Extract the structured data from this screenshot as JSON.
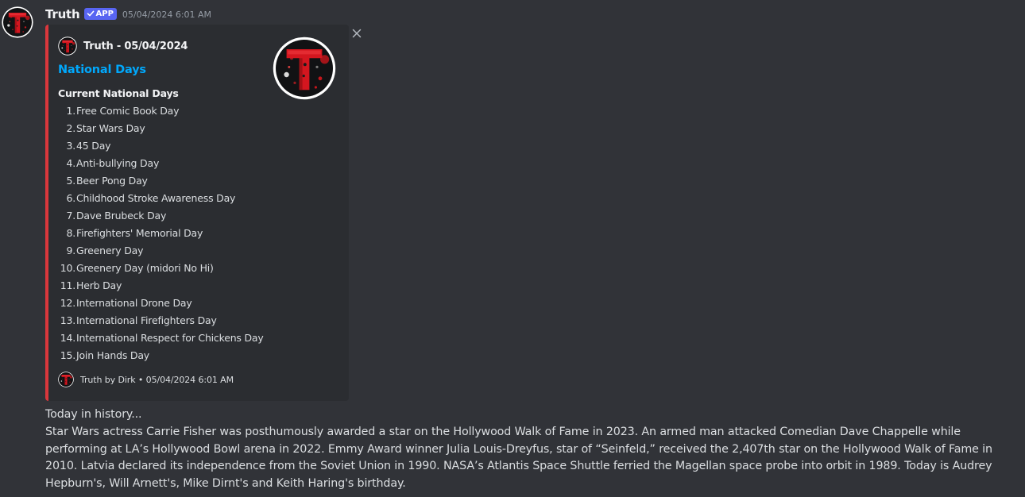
{
  "message": {
    "username": "Truth",
    "badge": "APP",
    "timestamp": "05/04/2024 6:01 AM",
    "avatar_icon": "truth-logo-icon"
  },
  "embed": {
    "accent_color": "#da373c",
    "author": "Truth - 05/04/2024",
    "title": "National Days",
    "field_name": "Current National Days",
    "days": [
      {
        "num": "1.",
        "label": "Free Comic Book Day"
      },
      {
        "num": "2.",
        "label": "Star Wars Day"
      },
      {
        "num": "3.",
        "label": "45 Day"
      },
      {
        "num": "4.",
        "label": "Anti-bullying Day"
      },
      {
        "num": "5.",
        "label": "Beer Pong Day"
      },
      {
        "num": "6.",
        "label": "Childhood Stroke Awareness Day"
      },
      {
        "num": "7.",
        "label": "Dave Brubeck Day"
      },
      {
        "num": "8.",
        "label": "Firefighters' Memorial Day"
      },
      {
        "num": "9.",
        "label": "Greenery Day"
      },
      {
        "num": "10.",
        "label": "Greenery Day (midori No Hi)"
      },
      {
        "num": "11.",
        "label": "Herb Day"
      },
      {
        "num": "12.",
        "label": "International Drone Day"
      },
      {
        "num": "13.",
        "label": "International Firefighters Day"
      },
      {
        "num": "14.",
        "label": "International Respect for Chickens Day"
      },
      {
        "num": "15.",
        "label": "Join Hands Day"
      }
    ],
    "footer": "Truth by Dirk • 05/04/2024 6:01 AM"
  },
  "content": {
    "heading": "Today in history...",
    "text": "Star Wars actress Carrie Fisher was posthumously awarded a star on the Hollywood Walk of Fame in 2023. An armed man attacked Comedian Dave Chappelle while performing at LA’s Hollywood Bowl arena in 2022. Emmy Award winner Julia Louis-Dreyfus, star of “Seinfeld,” received the 2,407th star on the Hollywood Walk of Fame in 2010. Latvia declared its independence from the Soviet Union in 1990. NASA’s Atlantis Space Shuttle ferried the Magellan space probe into orbit in 1989. Today is Audrey Hepburn's, Will Arnett's, Mike Dirnt's and Keith Haring's birthday."
  },
  "colors": {
    "background": "#313338",
    "embed_background": "#2b2d31",
    "link": "#00a8fc",
    "badge": "#5865f2"
  }
}
